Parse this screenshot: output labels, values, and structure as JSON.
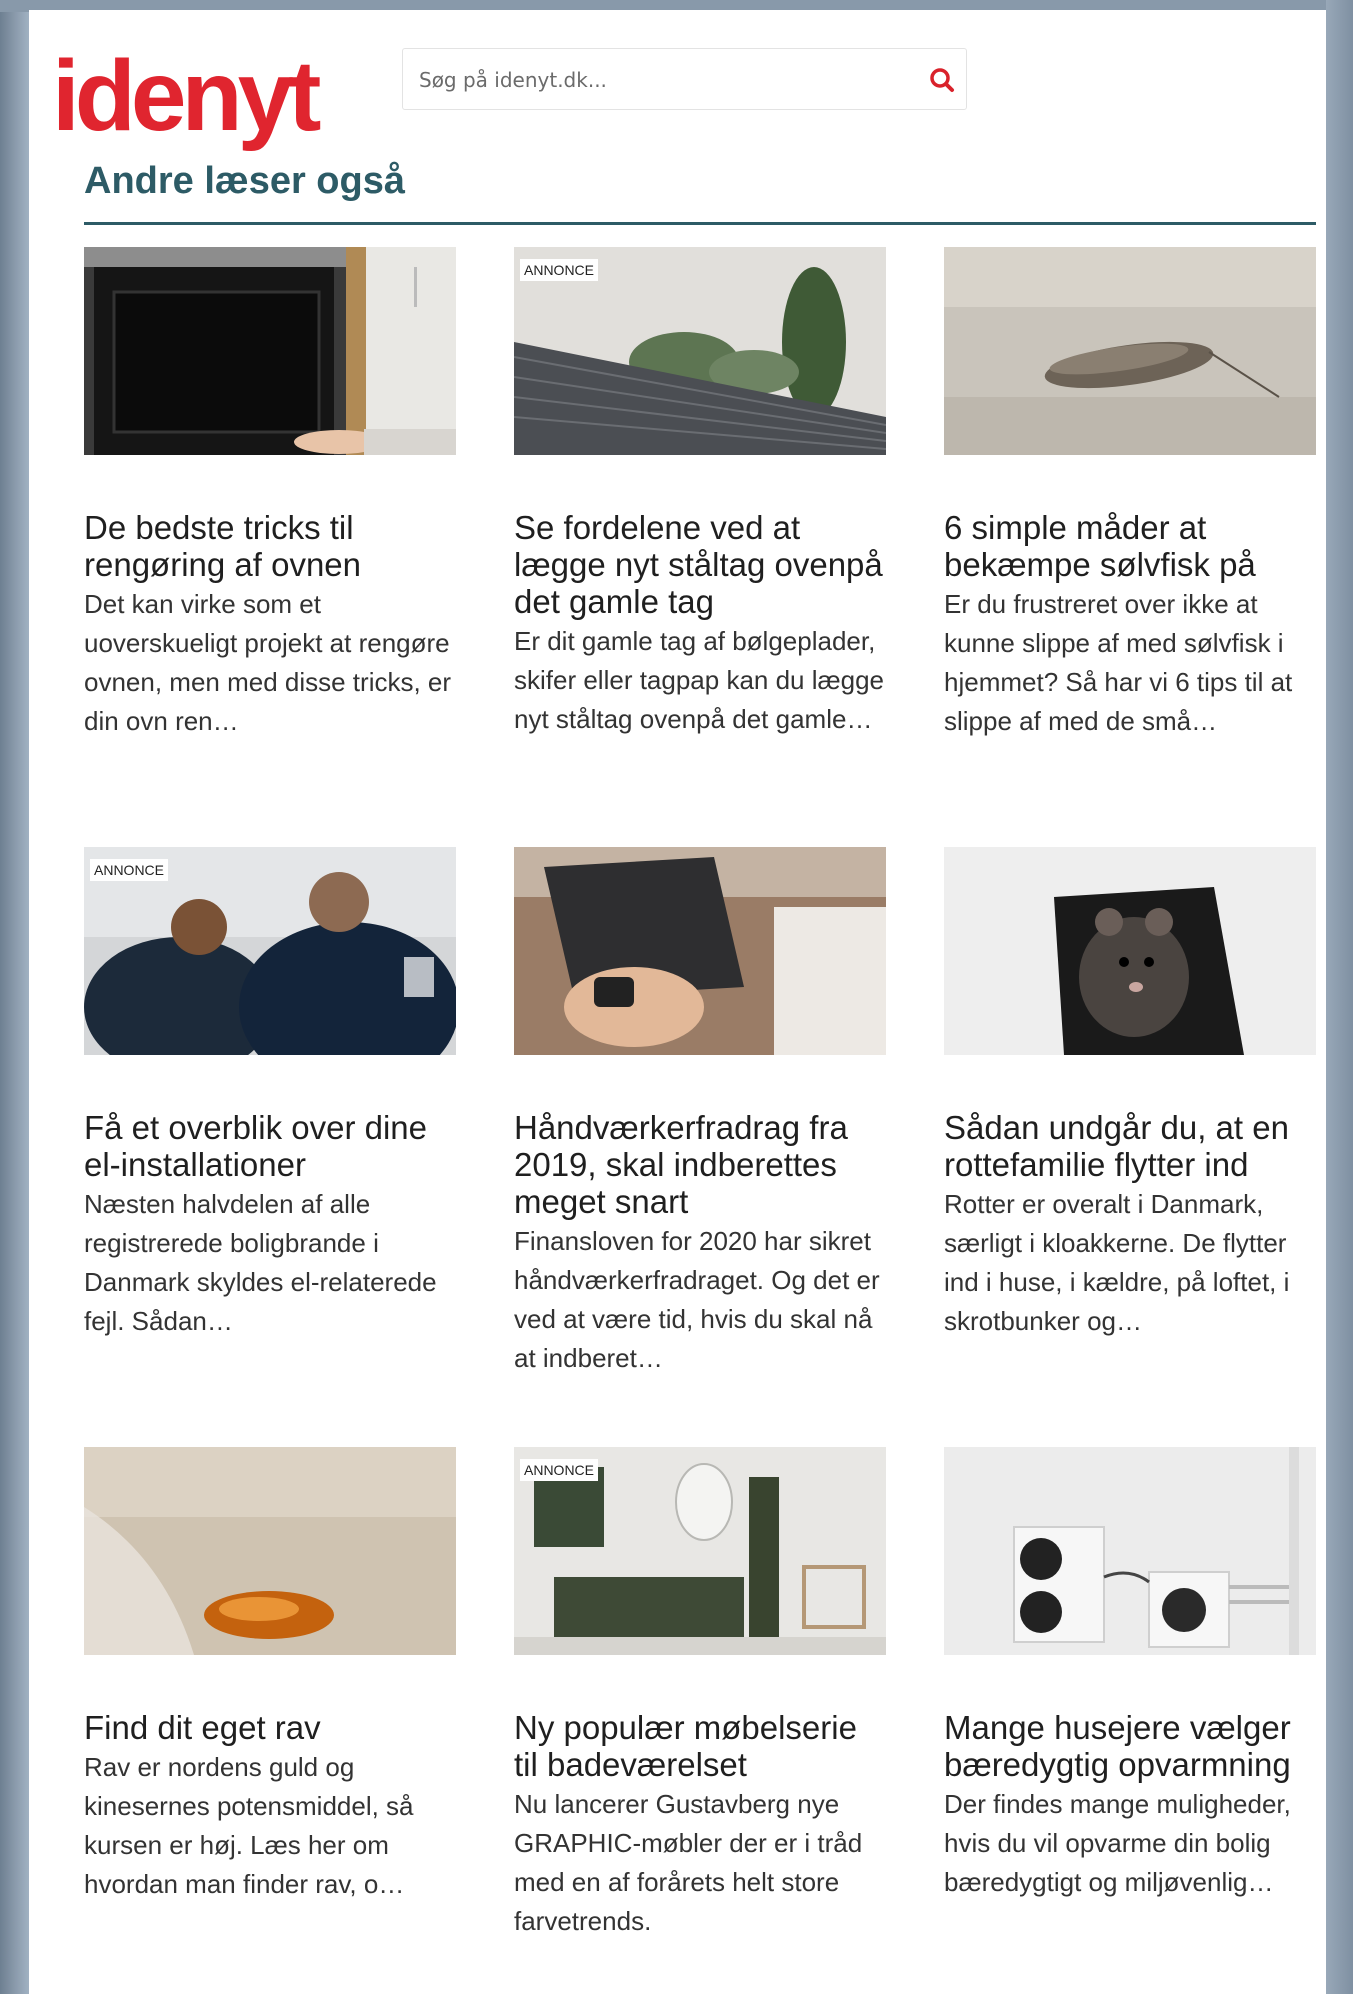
{
  "site": {
    "logo_text": "idenyt",
    "brand_color": "#e0252f",
    "accent_color": "#2d5b66"
  },
  "search": {
    "placeholder": "Søg på idenyt.dk...",
    "icon": "search-icon"
  },
  "section": {
    "title": "Andre læser også"
  },
  "articles": [
    {
      "title": "De bedste tricks til rengøring af ovnen",
      "desc": "Det kan virke som et uoverskueligt projekt at rengøre ovnen, men med disse tricks, er din ovn ren…",
      "badge": ""
    },
    {
      "title": "Se fordelene ved at lægge nyt ståltag ovenpå det gamle tag",
      "desc": "Er dit gamle tag af bølgeplader, skifer eller tagpap kan du lægge nyt ståltag ovenpå det gamle…",
      "badge": "ANNONCE"
    },
    {
      "title": "6 simple måder at bekæmpe sølvfisk på",
      "desc": "Er du frustreret over ikke at kunne slippe af med sølvfisk i hjemmet? Så har vi 6 tips til at slippe af med de små…",
      "badge": ""
    },
    {
      "title": "Få et overblik over dine el-installationer",
      "desc": "Næsten halvdelen af alle registrerede boligbrande i Danmark skyldes el-relaterede fejl. Sådan…",
      "badge": "ANNONCE"
    },
    {
      "title": "Håndværkerfradrag fra 2019, skal indberettes meget snart",
      "desc": "Finansloven for 2020 har sikret håndværkerfradraget. Og det er ved at være tid, hvis du skal nå at indberet…",
      "badge": ""
    },
    {
      "title": "Sådan undgår du, at en rottefamilie flytter ind",
      "desc": "Rotter er overalt i Danmark, særligt i kloakkerne. De flytter ind i huse, i kældre, på loftet, i skrotbunker og…",
      "badge": ""
    },
    {
      "title": "Find dit eget rav",
      "desc": "Rav er nordens guld og kinesernes potensmiddel, så kursen er høj. Læs her om hvordan man finder rav, o…",
      "badge": ""
    },
    {
      "title": "Ny populær møbelserie til badeværelset",
      "desc": "Nu lancerer Gustavberg nye GRAPHIC-møbler der er i tråd med en af forårets helt store farvetrends.",
      "badge": "ANNONCE"
    },
    {
      "title": "Mange husejere vælger bæredygtig opvarmning",
      "desc": "Der findes mange muligheder, hvis du vil opvarme din bolig bæredygtigt og miljøvenlig…",
      "badge": ""
    }
  ]
}
